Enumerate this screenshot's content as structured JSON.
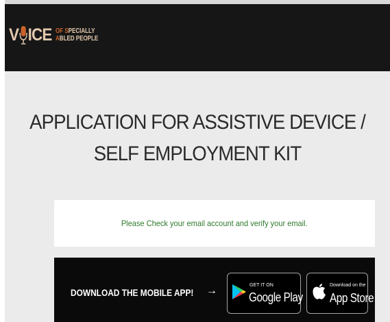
{
  "header": {
    "logo": {
      "word_start": "V",
      "word_end": "ICE",
      "line1_initial": "OF S",
      "line1_rest": "PECIALLY",
      "line2_initial": "A",
      "line2_rest": "BLED PEOPLE",
      "icon": "microphone-icon"
    }
  },
  "main": {
    "title_line1": "APPLICATION FOR ASSISTIVE DEVICE /",
    "title_line2": "SELF EMPLOYMENT KIT",
    "notice": "Please Check your email account and verify your email."
  },
  "footer": {
    "cta": "DOWNLOAD THE MOBILE APP!",
    "arrow": "→",
    "google_play": {
      "small": "GET IT ON",
      "big": "Google Play",
      "icon": "google-play-icon"
    },
    "app_store": {
      "small": "Download on the",
      "big": "App Store",
      "icon": "apple-icon"
    }
  },
  "colors": {
    "header_bg": "#161616",
    "page_bg": "#ebebeb",
    "logo_text": "#e3c9ad",
    "logo_accent": "#c9622b",
    "notice_text": "#2f7a2c",
    "footer_bg": "#0a0a0a"
  }
}
